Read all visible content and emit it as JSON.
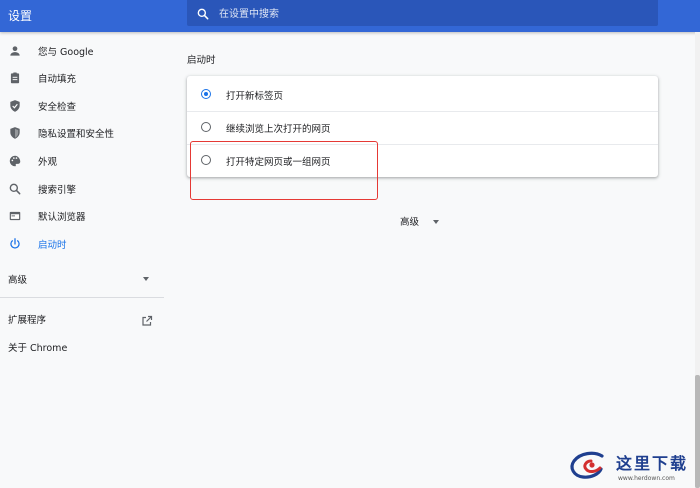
{
  "app": {
    "title": "设置"
  },
  "search": {
    "placeholder": "在设置中搜索",
    "value": ""
  },
  "sidebar": {
    "items": [
      {
        "label": "您与 Google",
        "icon": "person-icon"
      },
      {
        "label": "自动填充",
        "icon": "clipboard-icon"
      },
      {
        "label": "安全检查",
        "icon": "shield-check-icon"
      },
      {
        "label": "隐私设置和安全性",
        "icon": "shield-icon"
      },
      {
        "label": "外观",
        "icon": "palette-icon"
      },
      {
        "label": "搜索引擎",
        "icon": "search-icon"
      },
      {
        "label": "默认浏览器",
        "icon": "browser-icon"
      },
      {
        "label": "启动时",
        "icon": "power-icon",
        "active": true
      }
    ],
    "advanced": "高级",
    "extensions": "扩展程序",
    "about": "关于 Chrome"
  },
  "main": {
    "section_title": "启动时",
    "options": [
      {
        "label": "打开新标签页",
        "checked": true
      },
      {
        "label": "继续浏览上次打开的网页",
        "checked": false
      },
      {
        "label": "打开特定网页或一组网页",
        "checked": false
      }
    ],
    "advanced_toggle": "高级"
  },
  "watermark": {
    "text": "这里下载",
    "url": "www.herdown.com"
  },
  "colors": {
    "topbar": "#3367d6",
    "accent": "#1a73e8",
    "highlight": "#e53935"
  }
}
